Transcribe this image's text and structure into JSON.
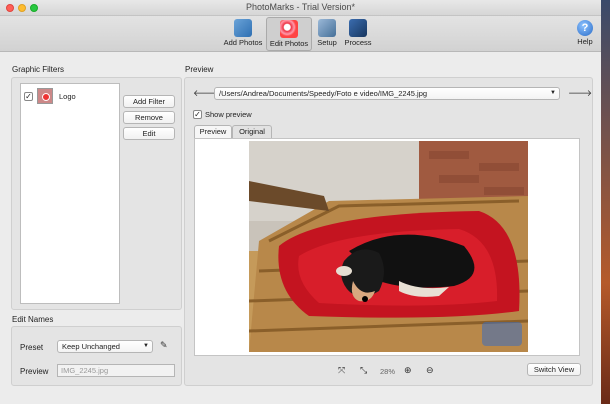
{
  "window": {
    "title": "PhotoMarks - Trial Version*"
  },
  "toolbar": {
    "add_photos": "Add Photos",
    "edit_photos": "Edit Photos",
    "setup": "Setup",
    "process": "Process",
    "help": "Help"
  },
  "filters": {
    "heading": "Graphic Filters",
    "items": [
      {
        "label": "Logo",
        "checked": true
      }
    ],
    "add_filter": "Add Filter",
    "remove": "Remove",
    "edit": "Edit"
  },
  "edit_names": {
    "heading": "Edit Names",
    "preset_label": "Preset",
    "preset_value": "Keep Unchanged",
    "preview_label": "Preview",
    "preview_value": "IMG_2245.jpg"
  },
  "preview": {
    "heading": "Preview",
    "path": "/Users/Andrea/Documents/Speedy/Foto e video/IMG_2245.jpg",
    "show_preview_label": "Show preview",
    "show_preview_checked": true,
    "tabs": [
      "Preview",
      "Original"
    ],
    "zoom": "28%",
    "switch_view": "Switch View"
  },
  "colors": {
    "accent": "#2e6fb2",
    "check": "#000000"
  }
}
